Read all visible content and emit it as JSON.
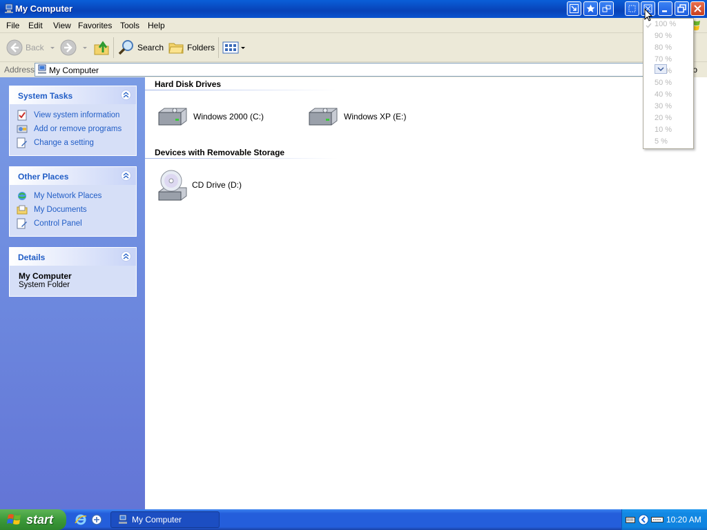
{
  "window": {
    "title": "My Computer"
  },
  "menu": {
    "items": [
      "File",
      "Edit",
      "View",
      "Favorites",
      "Tools",
      "Help"
    ]
  },
  "toolbar": {
    "back_label": "Back",
    "search_label": "Search",
    "folders_label": "Folders"
  },
  "address": {
    "label": "Address",
    "value": "My Computer",
    "go_label": "Go"
  },
  "panels": {
    "system_tasks": {
      "title": "System Tasks",
      "items": [
        "View system information",
        "Add or remove programs",
        "Change a setting"
      ]
    },
    "other_places": {
      "title": "Other Places",
      "items": [
        "My Network Places",
        "My Documents",
        "Control Panel"
      ]
    },
    "details": {
      "title": "Details",
      "name": "My Computer",
      "type": "System Folder"
    }
  },
  "groups": {
    "hard_disks": {
      "title": "Hard Disk Drives",
      "drives": [
        "Windows 2000 (C:)",
        "Windows XP (E:)"
      ]
    },
    "removable": {
      "title": "Devices with Removable Storage",
      "drives": [
        "CD Drive (D:)"
      ]
    }
  },
  "zoom_menu": {
    "options": [
      "100 %",
      "90 %",
      "80 %",
      "70 %",
      "60 %",
      "50 %",
      "40 %",
      "30 %",
      "20 %",
      "10 %",
      "5 %"
    ],
    "selected": "100 %"
  },
  "taskbar": {
    "start_label": "start",
    "task_label": "My Computer",
    "clock": "10:20 AM"
  },
  "colors": {
    "title_bar": "#0842b8",
    "task_link": "#215dc6",
    "left_pane": "#6f8de0",
    "start_green": "#3c9a3a"
  }
}
